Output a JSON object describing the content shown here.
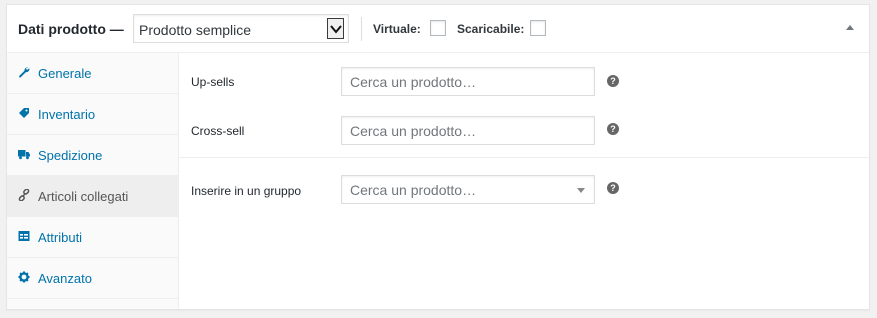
{
  "header": {
    "title": "Dati prodotto —",
    "product_type": {
      "selected": "Prodotto semplice"
    },
    "virtual_label": "Virtuale:",
    "downloadable_label": "Scaricabile:"
  },
  "sidebar": {
    "tabs": [
      {
        "label": "Generale",
        "icon": "wrench-icon"
      },
      {
        "label": "Inventario",
        "icon": "tag-icon"
      },
      {
        "label": "Spedizione",
        "icon": "truck-icon"
      },
      {
        "label": "Articoli collegati",
        "icon": "link-icon",
        "active": true
      },
      {
        "label": "Attributi",
        "icon": "table-icon"
      },
      {
        "label": "Avanzato",
        "icon": "gear-icon"
      }
    ]
  },
  "linked": {
    "upsells": {
      "label": "Up-sells",
      "placeholder": "Cerca un prodotto…"
    },
    "crosssell": {
      "label": "Cross-sell",
      "placeholder": "Cerca un prodotto…"
    },
    "grouped": {
      "label": "Inserire in un gruppo",
      "placeholder": "Cerca un prodotto…"
    },
    "help_glyph": "?"
  },
  "colors": {
    "link": "#0073aa",
    "active_tab_bg": "#eeeeee",
    "help_icon": "#666666"
  }
}
